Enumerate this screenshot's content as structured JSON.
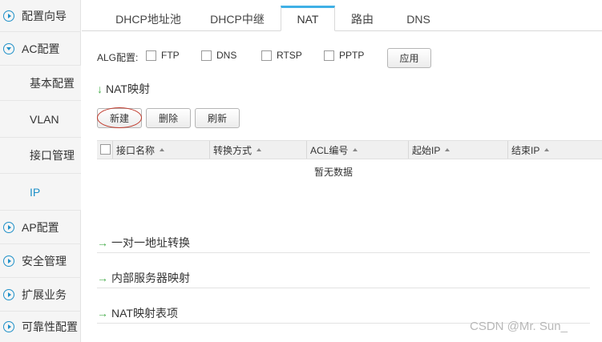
{
  "sidebar": {
    "items": [
      {
        "label": "配置向导",
        "level": "top",
        "icon": "play-circle-icon"
      },
      {
        "label": "AC配置",
        "level": "top",
        "icon": "expanded-circle-icon"
      },
      {
        "label": "基本配置",
        "level": "sub"
      },
      {
        "label": "VLAN",
        "level": "sub"
      },
      {
        "label": "接口管理",
        "level": "sub"
      },
      {
        "label": "IP",
        "level": "sub",
        "active": true
      },
      {
        "label": "AP配置",
        "level": "top",
        "icon": "play-circle-icon"
      },
      {
        "label": "安全管理",
        "level": "top",
        "icon": "play-circle-icon"
      },
      {
        "label": "扩展业务",
        "level": "top",
        "icon": "play-circle-icon"
      },
      {
        "label": "可靠性配置",
        "level": "top",
        "icon": "play-circle-icon"
      }
    ]
  },
  "tabs": [
    {
      "label": "DHCP地址池"
    },
    {
      "label": "DHCP中继"
    },
    {
      "label": "NAT",
      "active": true
    },
    {
      "label": "路由"
    },
    {
      "label": "DNS"
    }
  ],
  "alg": {
    "label": "ALG配置:",
    "options": [
      "FTP",
      "DNS",
      "RTSP",
      "PPTP"
    ],
    "apply_label": "应用"
  },
  "nat_mapping": {
    "title": "NAT映射",
    "buttons": {
      "new": "新建",
      "delete": "删除",
      "refresh": "刷新"
    },
    "columns": [
      "接口名称",
      "转换方式",
      "ACL编号",
      "起始IP",
      "结束IP"
    ],
    "empty_text": "暂无数据"
  },
  "sections": {
    "one_to_one": "一对一地址转换",
    "internal_server": "内部服务器映射",
    "nat_table": "NAT映射表项"
  },
  "watermark": "CSDN @Mr. Sun_",
  "colors": {
    "accent": "#1e90c8",
    "tab_top": "#3fb0e6",
    "arrow": "#4caf50",
    "highlight": "#c0392b"
  }
}
